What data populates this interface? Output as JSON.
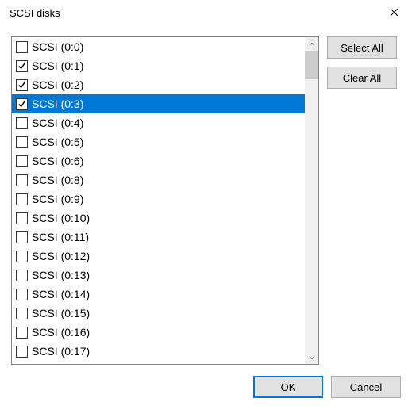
{
  "window": {
    "title": "SCSI disks"
  },
  "buttons": {
    "select_all": "Select All",
    "clear_all": "Clear All",
    "ok": "OK",
    "cancel": "Cancel"
  },
  "selected_index": 3,
  "items": [
    {
      "label": "SCSI (0:0)",
      "checked": false
    },
    {
      "label": "SCSI (0:1)",
      "checked": true
    },
    {
      "label": "SCSI (0:2)",
      "checked": true
    },
    {
      "label": "SCSI (0:3)",
      "checked": true
    },
    {
      "label": "SCSI (0:4)",
      "checked": false
    },
    {
      "label": "SCSI (0:5)",
      "checked": false
    },
    {
      "label": "SCSI (0:6)",
      "checked": false
    },
    {
      "label": "SCSI (0:8)",
      "checked": false
    },
    {
      "label": "SCSI (0:9)",
      "checked": false
    },
    {
      "label": "SCSI (0:10)",
      "checked": false
    },
    {
      "label": "SCSI (0:11)",
      "checked": false
    },
    {
      "label": "SCSI (0:12)",
      "checked": false
    },
    {
      "label": "SCSI (0:13)",
      "checked": false
    },
    {
      "label": "SCSI (0:14)",
      "checked": false
    },
    {
      "label": "SCSI (0:15)",
      "checked": false
    },
    {
      "label": "SCSI (0:16)",
      "checked": false
    },
    {
      "label": "SCSI (0:17)",
      "checked": false
    }
  ]
}
